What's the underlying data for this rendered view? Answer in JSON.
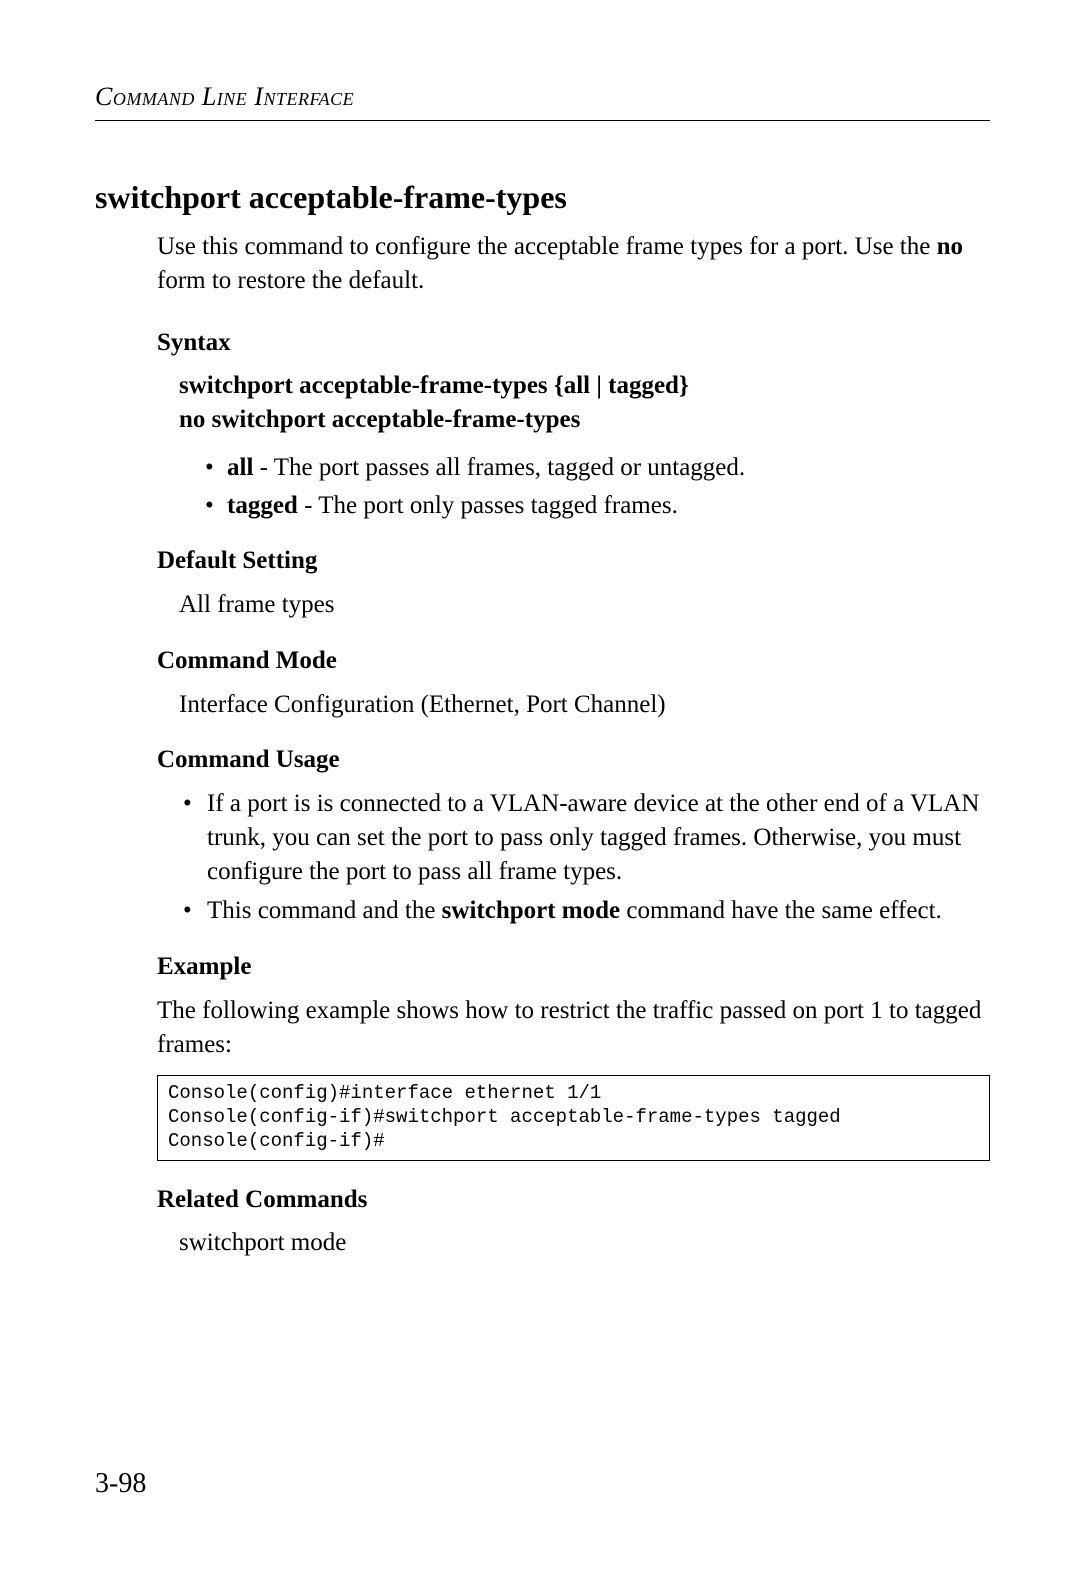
{
  "header": {
    "running_head": "Command Line Interface"
  },
  "title": "switchport acceptable-frame-types",
  "intro": {
    "pre": "Use this command to configure the acceptable frame types for a port. Use the ",
    "bold": "no",
    "post": " form to restore the default."
  },
  "syntax": {
    "label": "Syntax",
    "line1": "switchport acceptable-frame-types {all | tagged}",
    "line2": "no switchport acceptable-frame-types",
    "options": [
      {
        "term": "all",
        "desc": " - The port passes all frames, tagged or untagged."
      },
      {
        "term": "tagged",
        "desc": " - The port only passes tagged frames."
      }
    ]
  },
  "default_setting": {
    "label": "Default Setting",
    "text": "All frame types"
  },
  "command_mode": {
    "label": "Command Mode",
    "text": "Interface Configuration (Ethernet, Port Channel)"
  },
  "command_usage": {
    "label": "Command Usage",
    "items": [
      "If a port is is connected to a VLAN-aware device at the other end of a VLAN trunk, you can set the port to pass only tagged frames. Otherwise, you must configure the port to pass all frame types.",
      {
        "pre": "This command and the ",
        "bold": "switchport mode",
        "post": " command have the same effect."
      }
    ]
  },
  "example": {
    "label": "Example",
    "intro": "The following example shows how to restrict the traffic passed on port 1 to tagged frames:",
    "code": "Console(config)#interface ethernet 1/1\nConsole(config-if)#switchport acceptable-frame-types tagged\nConsole(config-if)#"
  },
  "related": {
    "label": "Related Commands",
    "text": "switchport mode"
  },
  "page_number": "3-98"
}
